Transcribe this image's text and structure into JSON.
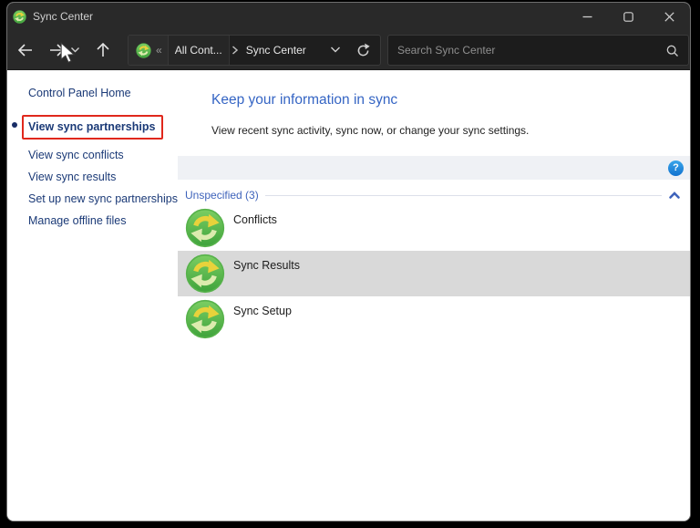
{
  "titlebar": {
    "title": "Sync Center",
    "icons": {
      "app": "sync-arrows-icon",
      "minimize": "minimize-icon",
      "maximize": "maximize-icon",
      "close": "close-icon"
    }
  },
  "toolbar": {
    "icons": {
      "back": "arrow-left-icon",
      "forward": "arrow-right-icon",
      "history": "chevron-down-icon",
      "up": "arrow-up-icon",
      "refresh": "refresh-icon",
      "search": "magnifier-icon"
    },
    "address": {
      "overflow_chevron": "«",
      "crumbs": [
        "All Cont...",
        "Sync Center"
      ]
    },
    "search": {
      "placeholder": "Search Sync Center",
      "value": ""
    }
  },
  "sidebar": {
    "home": "Control Panel Home",
    "items": [
      {
        "label": "View sync partnerships",
        "active": true,
        "annotated": "red-rectangle"
      },
      {
        "label": "View sync conflicts"
      },
      {
        "label": "View sync results"
      },
      {
        "label": "Set up new sync partnerships"
      },
      {
        "label": "Manage offline files"
      }
    ]
  },
  "main": {
    "heading": "Keep your information in sync",
    "subtext": "View recent sync activity, sync now, or change your sync settings.",
    "help_label": "?",
    "group": {
      "label": "Unspecified (3)",
      "collapsed": false
    },
    "items": [
      {
        "label": "Conflicts",
        "selected": false
      },
      {
        "label": "Sync Results",
        "selected": true
      },
      {
        "label": "Sync Setup",
        "selected": false
      }
    ]
  },
  "colors": {
    "titlebar_bg": "#292929",
    "link_navy": "#1b3a77",
    "heading_blue": "#3565c4",
    "group_blue": "#3e63bb",
    "selection_gray": "#d9d9d9",
    "commandbar_bg": "#eff1f5",
    "annotation_red": "#e0281c",
    "help_blue": "#1272cf",
    "icon_green": "#3fa33c",
    "icon_arrow_yellow": "#e8d23b",
    "icon_arrow_pale": "#dcebae"
  }
}
